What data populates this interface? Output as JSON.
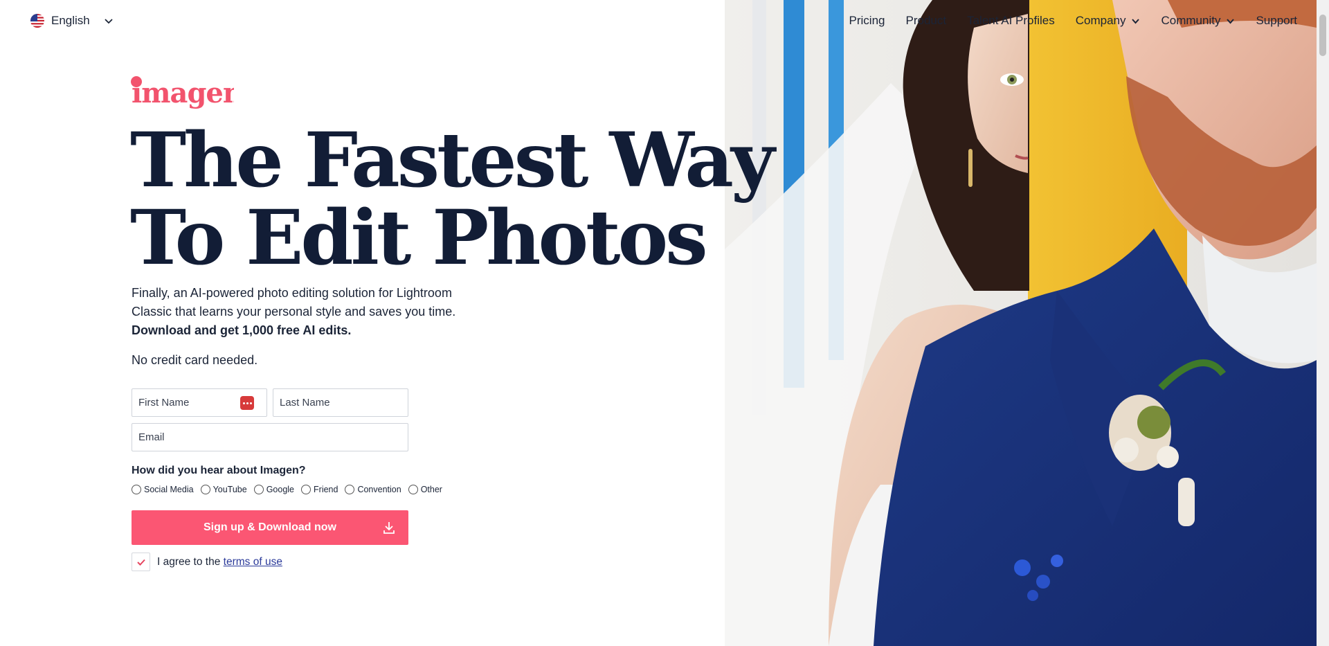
{
  "language": {
    "label": "English",
    "flag_icon": "us-flag-icon"
  },
  "nav": {
    "items": [
      {
        "label": "Pricing",
        "dropdown": false
      },
      {
        "label": "Product",
        "dropdown": false
      },
      {
        "label": "Talent AI Profiles",
        "dropdown": false
      },
      {
        "label": "Company",
        "dropdown": true
      },
      {
        "label": "Community",
        "dropdown": true
      },
      {
        "label": "Support",
        "dropdown": false
      }
    ]
  },
  "logo": {
    "text": "imagen",
    "color": "#f2536d"
  },
  "hero": {
    "headline_line1": "The Fastest Way",
    "headline_line2": "To Edit Photos",
    "subtitle_line1": "Finally, an AI-powered photo editing solution for Lightroom",
    "subtitle_line2": "Classic that learns your personal style and saves you time.",
    "subtitle_bold": "Download and get 1,000 free AI edits.",
    "no_card": "No credit card needed."
  },
  "form": {
    "first_name_placeholder": "First Name",
    "last_name_placeholder": "Last Name",
    "email_placeholder": "Email",
    "question": "How did you hear about Imagen?",
    "options": [
      "Social Media",
      "YouTube",
      "Google",
      "Friend",
      "Convention",
      "Other"
    ],
    "submit_label": "Sign up & Download now",
    "agree_prefix": "I agree to the ",
    "agree_link": "terms of use",
    "agree_checked": true
  },
  "colors": {
    "accent": "#fb5673",
    "heading": "#121d36",
    "text": "#1b2437"
  }
}
